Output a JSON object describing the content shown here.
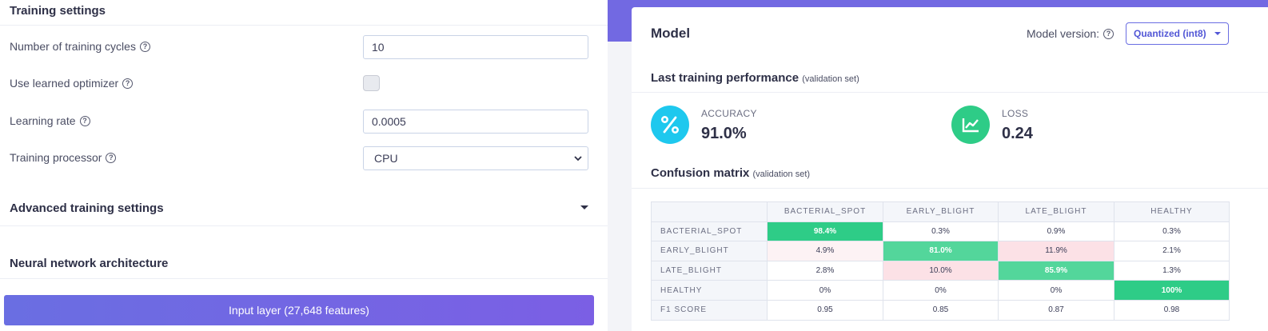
{
  "training_settings": {
    "title": "Training settings",
    "cycles_label": "Number of training cycles",
    "cycles_value": "10",
    "learned_optimizer_label": "Use learned optimizer",
    "learned_optimizer_checked": false,
    "learning_rate_label": "Learning rate",
    "learning_rate_value": "0.0005",
    "processor_label": "Training processor",
    "processor_value": "CPU",
    "advanced_label": "Advanced training settings",
    "nn_title": "Neural network architecture",
    "input_layer_label": "Input layer (27,648 features)"
  },
  "model": {
    "title": "Model",
    "version_label": "Model version:",
    "version_value": "Quantized (int8)",
    "last_perf_title": "Last training performance",
    "last_perf_note": "(validation set)",
    "accuracy_label": "ACCURACY",
    "accuracy_value": "91.0%",
    "loss_label": "LOSS",
    "loss_value": "0.24",
    "confusion_title": "Confusion matrix",
    "confusion_note": "(validation set)",
    "colors": {
      "accuracy_icon": "#1ec8ee",
      "loss_icon": "#2ecc87",
      "accent": "#6a6ee2"
    }
  },
  "confusion_matrix": {
    "columns": [
      "BACTERIAL_SPOT",
      "EARLY_BLIGHT",
      "LATE_BLIGHT",
      "HEALTHY"
    ],
    "rows": [
      {
        "label": "BACTERIAL_SPOT",
        "cells": [
          "98.4%",
          "0.3%",
          "0.9%",
          "0.3%"
        ]
      },
      {
        "label": "EARLY_BLIGHT",
        "cells": [
          "4.9%",
          "81.0%",
          "11.9%",
          "2.1%"
        ]
      },
      {
        "label": "LATE_BLIGHT",
        "cells": [
          "2.8%",
          "10.0%",
          "85.9%",
          "1.3%"
        ]
      },
      {
        "label": "HEALTHY",
        "cells": [
          "0%",
          "0%",
          "0%",
          "100%"
        ]
      },
      {
        "label": "F1 SCORE",
        "cells": [
          "0.95",
          "0.85",
          "0.87",
          "0.98"
        ]
      }
    ]
  }
}
